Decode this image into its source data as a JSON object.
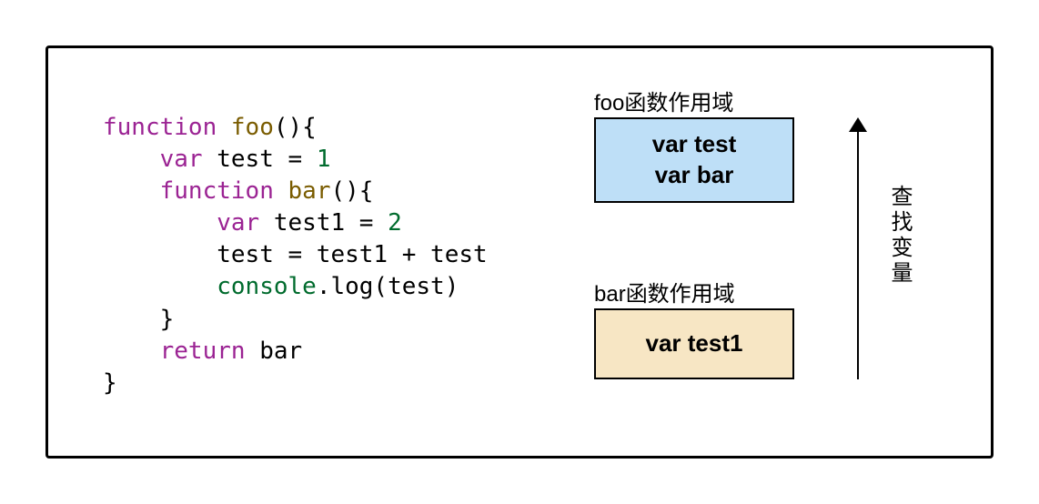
{
  "code": {
    "line1_kw": "function",
    "line1_fn": "foo",
    "line1_tail": "(){",
    "line2_kw": "var",
    "line2_rest": " test = ",
    "line2_num": "1",
    "line3_kw": "function",
    "line3_fn": "bar",
    "line3_tail": "(){",
    "line4_kw": "var",
    "line4_rest": " test1 = ",
    "line4_num": "2",
    "line5": "test = test1 + test",
    "line6_cons": "console",
    "line6_rest": ".log(test)",
    "line7": "}",
    "line8_kw": "return",
    "line8_rest": " bar",
    "line9": "}"
  },
  "scopes": {
    "foo": {
      "label": "foo函数作用域",
      "line1": "var test",
      "line2": "var bar"
    },
    "bar": {
      "label": "bar函数作用域",
      "line1": "var test1"
    }
  },
  "arrow": {
    "label": "查找变量"
  }
}
